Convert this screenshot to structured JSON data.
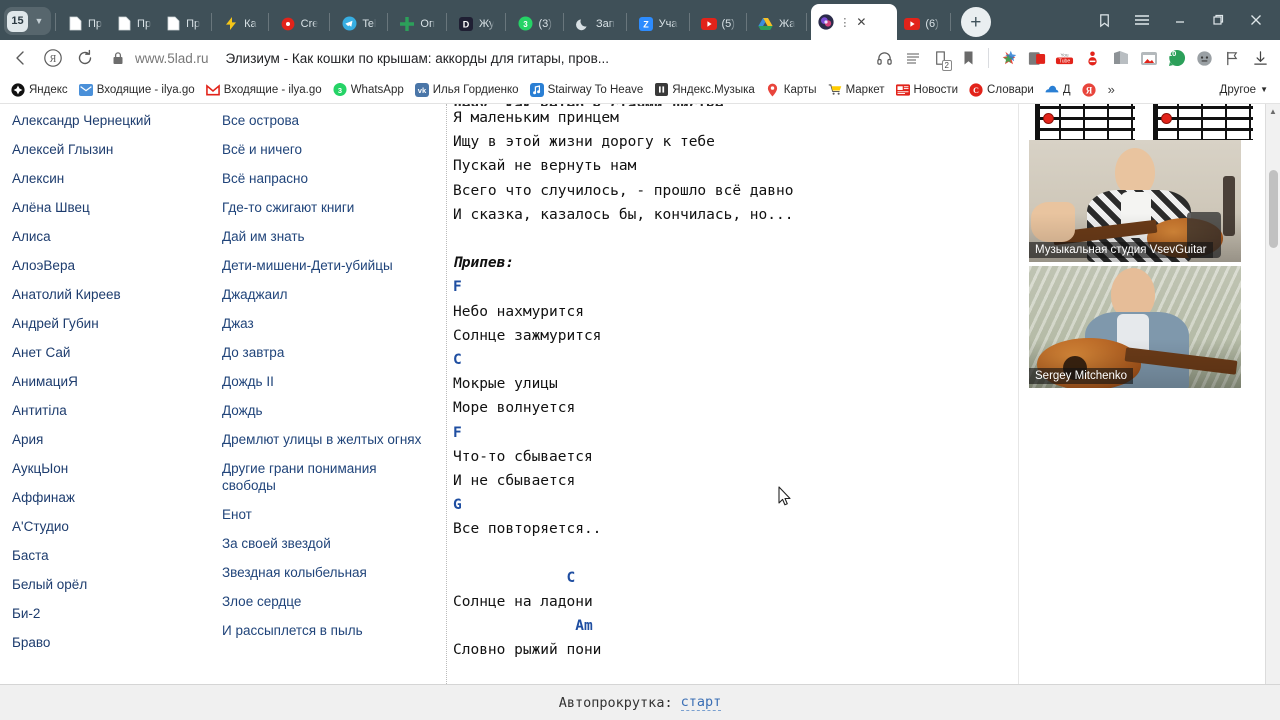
{
  "browser": {
    "tab_group": {
      "count": "15",
      "chevron": "chevron-down-icon"
    },
    "tabs": [
      {
        "label": "Пр",
        "icon": "doc-icon",
        "active": false
      },
      {
        "label": "Пр",
        "icon": "doc-icon",
        "active": false
      },
      {
        "label": "Пр",
        "icon": "doc-icon",
        "active": false
      },
      {
        "label": "Ка",
        "icon": "lightning-icon",
        "active": false
      },
      {
        "label": "Cre",
        "icon": "record-icon",
        "active": false
      },
      {
        "label": "Tel",
        "icon": "telegram-icon",
        "active": false
      },
      {
        "label": "Оп",
        "icon": "plus-green-icon",
        "active": false
      },
      {
        "label": "Жу",
        "icon": "discord-icon",
        "active": false
      },
      {
        "label": "(3)",
        "icon": "whatsapp-icon",
        "active": false
      },
      {
        "label": "Зап",
        "icon": "moon-icon",
        "active": false
      },
      {
        "label": "Уча",
        "icon": "zoom-icon",
        "active": false
      },
      {
        "label": "(5)",
        "icon": "youtube-icon",
        "active": false
      },
      {
        "label": "Жа",
        "icon": "drive-icon",
        "active": false
      },
      {
        "label": "",
        "icon": "5lad-icon",
        "active": true
      },
      {
        "label": "(6)",
        "icon": "youtube-icon",
        "active": false
      }
    ],
    "new_tab_label": "+",
    "window_controls": {
      "collections": "collections-icon",
      "menu": "hamburger-menu-icon",
      "minimize": "minimize-icon",
      "maximize": "maximize-icon",
      "close": "close-icon"
    },
    "nav": {
      "back": "back-arrow-icon",
      "yandex": "yandex-logo-icon",
      "reload": "reload-icon",
      "lock": "lock-icon",
      "host": "www.5lad.ru",
      "title": "Элизиум - Как кошки по крышам: аккорды для гитары, пров...",
      "right_icons": [
        "headphones-icon",
        "reader-mode-icon",
        "clipboard-2-icon",
        "bookmark-icon",
        "extension-star-icon",
        "extension-redblock-icon",
        "youtube-ext-icon",
        "adblock-icon",
        "extension-gray-icon",
        "extension-photo-icon",
        "extension-green-10-icon",
        "extension-face-icon",
        "extension-flag-icon",
        "download-icon"
      ],
      "badge_clipboard": "2",
      "badge_green": "10"
    },
    "bookmarks": [
      {
        "label": "Яндекс",
        "icon": "yandex-bm-icon",
        "color": "#000000"
      },
      {
        "label": "Входящие - ilya.go",
        "icon": "mail-blue-icon",
        "color": "#4a90d9"
      },
      {
        "label": "Входящие - ilya.go",
        "icon": "gmail-icon",
        "color": "#ffffff"
      },
      {
        "label": "WhatsApp",
        "icon": "whatsapp-icon",
        "color": "#25d366"
      },
      {
        "label": "Илья Гордиенко",
        "icon": "vk-icon",
        "color": "#4a76a8"
      },
      {
        "label": "Stairway To Heave",
        "icon": "music-blue-icon",
        "color": "#2a7fd4"
      },
      {
        "label": "Яндекс.Музыка",
        "icon": "pause-icon",
        "color": "#333333"
      },
      {
        "label": "Карты",
        "icon": "map-pin-icon",
        "color": "#e8453c"
      },
      {
        "label": "Маркет",
        "icon": "cart-icon",
        "color": "#ffcc00"
      },
      {
        "label": "Новости",
        "icon": "news-icon",
        "color": "#e8453c"
      },
      {
        "label": "Словари",
        "icon": "dictionary-icon",
        "color": "#e8453c"
      },
      {
        "label": "Д",
        "icon": "disk-icon",
        "color": "#2a7fd4"
      },
      {
        "label": "",
        "icon": "yandex-round-icon",
        "color": "#e8453c"
      }
    ],
    "bookmarks_overflow": "»",
    "bookmarks_other": {
      "label": "Другое",
      "chevron": "chevron-down-icon"
    }
  },
  "page": {
    "artists": [
      "Александр Чернецкий",
      "Алексей Глызин",
      "Алексин",
      "Алёна Швец",
      "Алиса",
      "АлоэВера",
      "Анатолий Киреев",
      "Андрей Губин",
      "Анет Сай",
      "АнимациЯ",
      "Антитіла",
      "Ария",
      "АукцЫон",
      "Аффинаж",
      "А'Студио",
      "Баста",
      "Белый орёл",
      "Би-2",
      "Браво"
    ],
    "songs": [
      "Все острова",
      "Всё и ничего",
      "Всё напрасно",
      "Где-то сжигают книги",
      "Дай им знать",
      "Дети-мишени-Дети-убийцы",
      "Джаджаил",
      "Джаз",
      "До завтра",
      "Дождь II",
      "Дождь",
      "Дремлют улицы в желтых огнях",
      "Другие грани понимания свободы",
      "Енот",
      "За своей звездой",
      "Звездная колыбельная",
      "Злое сердце",
      "И рассыплется в пыль"
    ],
    "lyrics": [
      {
        "type": "clipped",
        "text": "Лечу, как ветер в стаями листве"
      },
      {
        "type": "line",
        "text": "Я маленьким принцем"
      },
      {
        "type": "line",
        "text": "Ищу в этой жизни дорогу к тебе"
      },
      {
        "type": "line",
        "text": "Пускай не вернуть нам"
      },
      {
        "type": "line",
        "text": "Всего что случилось, - прошло всё давно"
      },
      {
        "type": "line",
        "text": "И сказка, казалось бы, кончилась, но..."
      },
      {
        "type": "blank",
        "text": ""
      },
      {
        "type": "italic",
        "text": "Припев:"
      },
      {
        "type": "chord",
        "text": "F"
      },
      {
        "type": "line",
        "text": "Небо нахмурится"
      },
      {
        "type": "line",
        "text": "Солнце зажмурится"
      },
      {
        "type": "chord",
        "text": "C"
      },
      {
        "type": "line",
        "text": "Мокрые улицы"
      },
      {
        "type": "line",
        "text": "Море волнуется"
      },
      {
        "type": "chord",
        "text": "F"
      },
      {
        "type": "line",
        "text": "Что-то сбывается"
      },
      {
        "type": "line",
        "text": "И не сбывается"
      },
      {
        "type": "chord",
        "text": "G"
      },
      {
        "type": "line",
        "text": "Все повторяется.."
      },
      {
        "type": "blank",
        "text": ""
      },
      {
        "type": "chord",
        "text": "             C"
      },
      {
        "type": "line",
        "text": "Солнце на ладони"
      },
      {
        "type": "chord",
        "text": "              Am"
      },
      {
        "type": "line",
        "text": "Словно рыжий пони"
      }
    ],
    "videos": [
      {
        "label": "Музыкальная студия VsevGuitar"
      },
      {
        "label": "Sergey Mitchenko"
      }
    ],
    "autoscroll": {
      "label": "Автопрокрутка:",
      "action": "старт"
    },
    "scrollbar": {
      "up": "▲",
      "down": "▼"
    }
  },
  "colors": {
    "link": "#1d3c6e",
    "chord": "#1f4ea1",
    "tabbar": "#3f5058",
    "accent_red": "#e2231a"
  }
}
